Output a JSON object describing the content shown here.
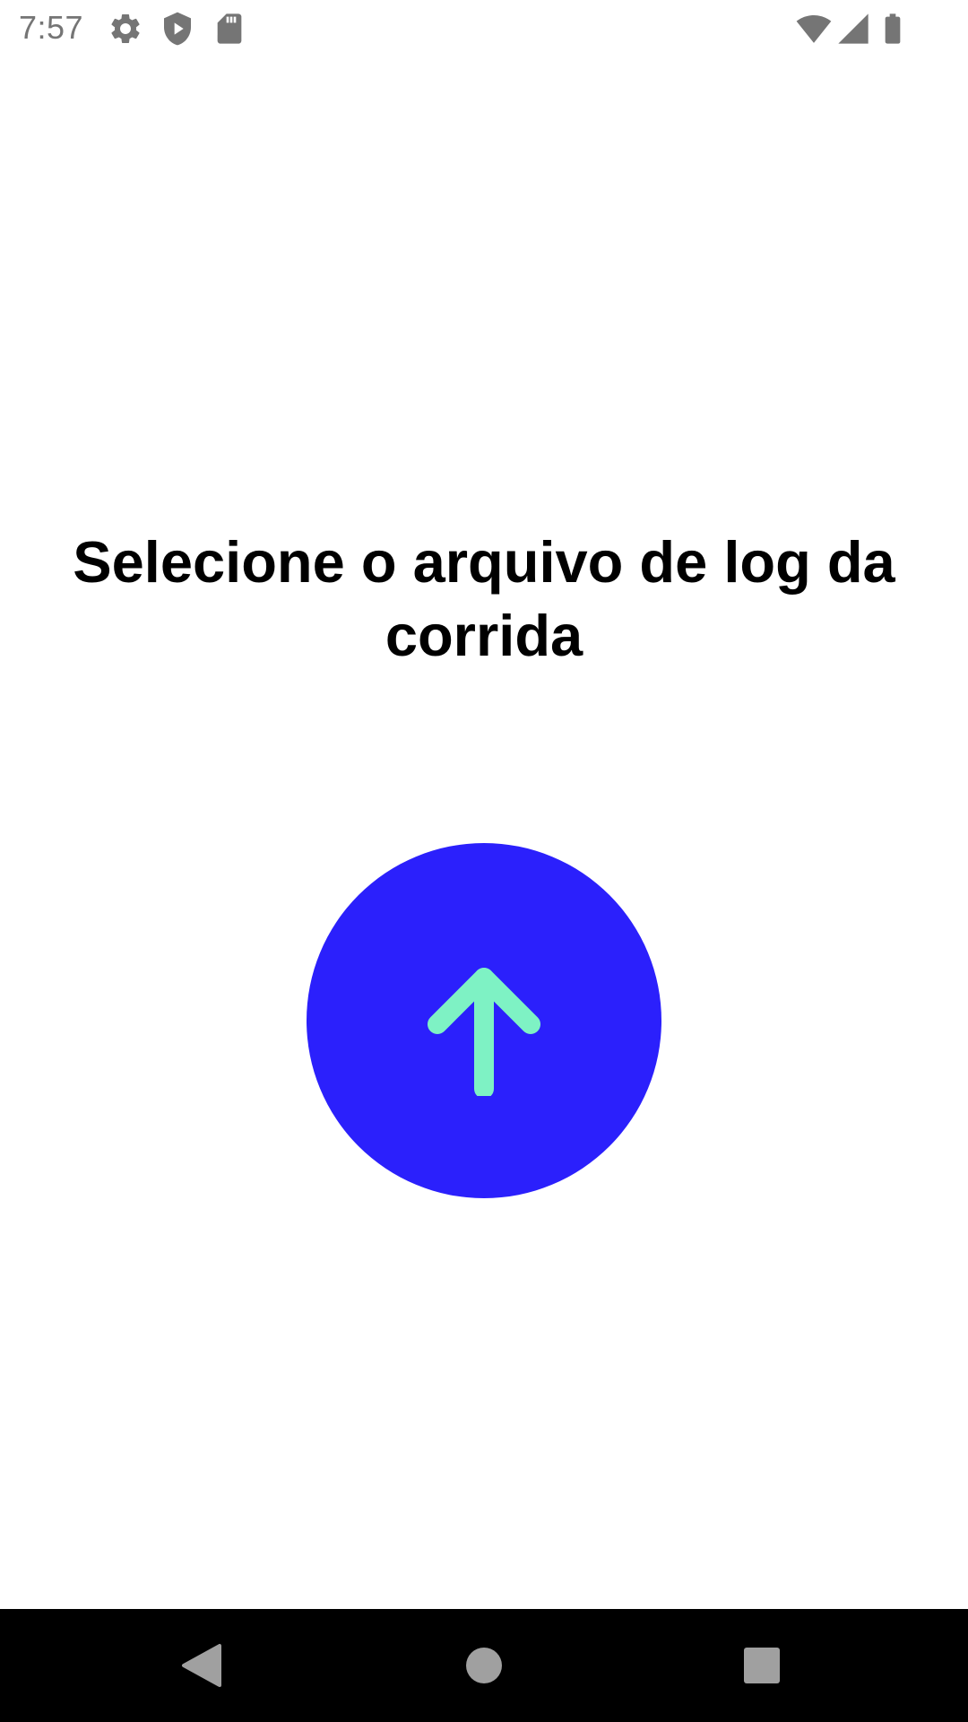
{
  "status_bar": {
    "time": "7:57",
    "left_icons": [
      "settings-icon",
      "play-protect-icon",
      "sd-card-icon"
    ],
    "right_icons": [
      "wifi-icon",
      "signal-icon",
      "battery-icon"
    ],
    "icon_color": "#757575"
  },
  "main": {
    "title": "Selecione o arquivo de log da corrida",
    "upload_button": {
      "icon": "arrow-up-icon",
      "background_color": "#2b20fc",
      "icon_color": "#7ef2c4"
    }
  },
  "nav_bar": {
    "buttons": [
      "back-icon",
      "home-icon",
      "recents-icon"
    ],
    "background_color": "#000000",
    "icon_color": "#a0a0a0"
  }
}
